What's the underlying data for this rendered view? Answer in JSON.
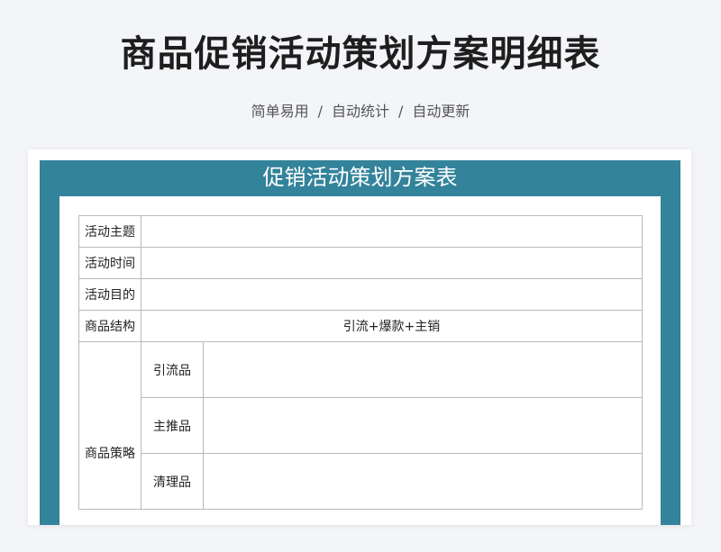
{
  "header": {
    "title": "商品促销活动策划方案明细表",
    "features": [
      "简单易用",
      "自动统计",
      "自动更新"
    ],
    "separator": "/"
  },
  "sheet": {
    "title": "促销活动策划方案表",
    "rows": {
      "theme_label": "活动主题",
      "time_label": "活动时间",
      "goal_label": "活动目的",
      "structure_label": "商品结构",
      "structure_value": "引流+爆款+主销",
      "strategy_label": "商品策略",
      "strategy_items": [
        "引流品",
        "主推品",
        "清理品"
      ]
    }
  },
  "colors": {
    "accent": "#33839a",
    "background": "#f3f5f8",
    "border": "#b9b9b9"
  }
}
